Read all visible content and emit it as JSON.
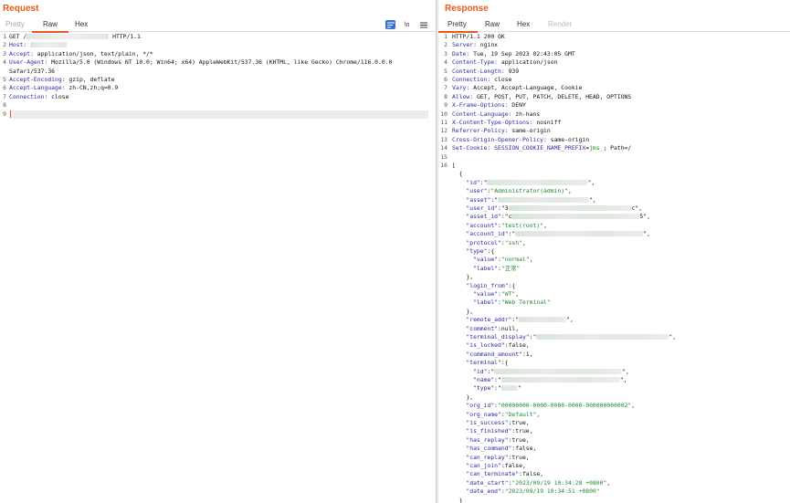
{
  "request": {
    "title": "Request",
    "tabs": [
      "Pretty",
      "Raw",
      "Hex"
    ],
    "active_tab": "Raw",
    "toolbar": {
      "newline_label": "\\n"
    },
    "lines": [
      {
        "n": "1",
        "parts": [
          {
            "t": "GET /",
            "c": "plain"
          },
          {
            "blur": 90,
            "gray": true
          },
          {
            "t": " HTTP/1.1",
            "c": "plain"
          }
        ]
      },
      {
        "n": "2",
        "parts": [
          {
            "t": "Host:",
            "c": "key"
          },
          {
            "t": " ",
            "c": "plain"
          },
          {
            "blur": 40,
            "gray": true
          }
        ]
      },
      {
        "n": "3",
        "parts": [
          {
            "t": "Accept:",
            "c": "key"
          },
          {
            "t": " application/json, text/plain, */*",
            "c": "plain"
          }
        ]
      },
      {
        "n": "4",
        "parts": [
          {
            "t": "User-Agent:",
            "c": "key"
          },
          {
            "t": " Mozilla/5.0 (Windows NT 10.0; Win64; x64) AppleWebKit/537.36 (KHTML, like Gecko) Chrome/116.0.0.0",
            "c": "plain"
          }
        ]
      },
      {
        "n": "",
        "parts": [
          {
            "t": "Safari/537.36",
            "c": "plain"
          }
        ]
      },
      {
        "n": "5",
        "parts": [
          {
            "t": "Accept-Encoding:",
            "c": "key"
          },
          {
            "t": " gzip, deflate",
            "c": "plain"
          }
        ]
      },
      {
        "n": "6",
        "parts": [
          {
            "t": "Accept-Language:",
            "c": "key"
          },
          {
            "t": " zh-CN,zh;q=0.9",
            "c": "plain"
          }
        ]
      },
      {
        "n": "7",
        "parts": [
          {
            "t": "Connection:",
            "c": "key"
          },
          {
            "t": " close",
            "c": "plain"
          }
        ]
      },
      {
        "n": "8",
        "parts": []
      },
      {
        "n": "9",
        "parts": [],
        "cursor": true
      }
    ]
  },
  "response": {
    "title": "Response",
    "tabs": [
      "Pretty",
      "Raw",
      "Hex",
      "Render"
    ],
    "active_tab": "Pretty",
    "lines": [
      {
        "n": "1",
        "parts": [
          {
            "t": "HTTP/1.1 200 OK",
            "c": "plain"
          }
        ]
      },
      {
        "n": "2",
        "parts": [
          {
            "t": "Server:",
            "c": "key"
          },
          {
            "t": " nginx",
            "c": "plain"
          }
        ]
      },
      {
        "n": "3",
        "parts": [
          {
            "t": "Date:",
            "c": "key"
          },
          {
            "t": " Tue, 19 Sep 2023 02:43:05 GMT",
            "c": "plain"
          }
        ]
      },
      {
        "n": "4",
        "parts": [
          {
            "t": "Content-Type:",
            "c": "key"
          },
          {
            "t": " application/json",
            "c": "plain"
          }
        ]
      },
      {
        "n": "5",
        "parts": [
          {
            "t": "Content-Length:",
            "c": "key"
          },
          {
            "t": " 939",
            "c": "plain"
          }
        ]
      },
      {
        "n": "6",
        "parts": [
          {
            "t": "Connection:",
            "c": "key"
          },
          {
            "t": " close",
            "c": "plain"
          }
        ]
      },
      {
        "n": "7",
        "parts": [
          {
            "t": "Vary:",
            "c": "key"
          },
          {
            "t": " Accept, Accept-Language, Cookie",
            "c": "plain"
          }
        ]
      },
      {
        "n": "8",
        "parts": [
          {
            "t": "Allow:",
            "c": "key"
          },
          {
            "t": " GET, POST, PUT, PATCH, DELETE, HEAD, OPTIONS",
            "c": "plain"
          }
        ]
      },
      {
        "n": "9",
        "parts": [
          {
            "t": "X-Frame-Options:",
            "c": "key"
          },
          {
            "t": " DENY",
            "c": "plain"
          }
        ]
      },
      {
        "n": "10",
        "parts": [
          {
            "t": "Content-Language:",
            "c": "key"
          },
          {
            "t": " zh-hans",
            "c": "plain"
          }
        ]
      },
      {
        "n": "11",
        "parts": [
          {
            "t": "X-Content-Type-Options:",
            "c": "key"
          },
          {
            "t": " nosniff",
            "c": "plain"
          }
        ]
      },
      {
        "n": "12",
        "parts": [
          {
            "t": "Referrer-Policy:",
            "c": "key"
          },
          {
            "t": " same-origin",
            "c": "plain"
          }
        ]
      },
      {
        "n": "13",
        "parts": [
          {
            "t": "Cross-Origin-Opener-Policy:",
            "c": "key"
          },
          {
            "t": " same-origin",
            "c": "plain"
          }
        ]
      },
      {
        "n": "14",
        "parts": [
          {
            "t": "Set-Cookie:",
            "c": "key"
          },
          {
            "t": " SESSION_COOKIE_NAME_PREFIX",
            "c": "key"
          },
          {
            "t": "=",
            "c": "plain"
          },
          {
            "t": "jms_",
            "c": "str"
          },
          {
            "t": "; Path=/",
            "c": "plain"
          }
        ]
      },
      {
        "n": "15",
        "parts": []
      },
      {
        "n": "16",
        "parts": [
          {
            "t": "[",
            "c": "plain"
          }
        ]
      },
      {
        "n": "",
        "parts": [
          {
            "t": "  {",
            "c": "plain"
          }
        ]
      },
      {
        "n": "",
        "parts": [
          {
            "t": "    \"id\"",
            "c": "key"
          },
          {
            "t": ":\"",
            "c": "plain"
          },
          {
            "blur": 110
          },
          {
            "t": "\",",
            "c": "plain"
          }
        ]
      },
      {
        "n": "",
        "parts": [
          {
            "t": "    \"user\"",
            "c": "key"
          },
          {
            "t": ":",
            "c": "plain"
          },
          {
            "t": "\"Administrator(admin)\"",
            "c": "str"
          },
          {
            "t": ",",
            "c": "plain"
          }
        ]
      },
      {
        "n": "",
        "parts": [
          {
            "t": "    \"asset\"",
            "c": "key"
          },
          {
            "t": ":\"",
            "c": "plain"
          },
          {
            "blur": 100
          },
          {
            "t": "\",",
            "c": "plain"
          }
        ]
      },
      {
        "n": "",
        "parts": [
          {
            "t": "    \"user_id\"",
            "c": "key"
          },
          {
            "t": ":\"3",
            "c": "plain"
          },
          {
            "blur": 135
          },
          {
            "t": "c\",",
            "c": "plain"
          }
        ]
      },
      {
        "n": "",
        "parts": [
          {
            "t": "    \"asset_id\"",
            "c": "key"
          },
          {
            "t": ":\"c",
            "c": "plain"
          },
          {
            "blur": 140
          },
          {
            "t": "5\",",
            "c": "plain"
          }
        ]
      },
      {
        "n": "",
        "parts": [
          {
            "t": "    \"account\"",
            "c": "key"
          },
          {
            "t": ":",
            "c": "plain"
          },
          {
            "t": "\"test(root)\"",
            "c": "str"
          },
          {
            "t": ",",
            "c": "plain"
          }
        ]
      },
      {
        "n": "",
        "parts": [
          {
            "t": "    \"account_id\"",
            "c": "key"
          },
          {
            "t": ":\"",
            "c": "plain"
          },
          {
            "blur": 140
          },
          {
            "t": "\",",
            "c": "plain"
          }
        ]
      },
      {
        "n": "",
        "parts": [
          {
            "t": "    \"protocol\"",
            "c": "key"
          },
          {
            "t": ":",
            "c": "plain"
          },
          {
            "t": "\"ssh\"",
            "c": "str"
          },
          {
            "t": ",",
            "c": "plain"
          }
        ]
      },
      {
        "n": "",
        "parts": [
          {
            "t": "    \"type\"",
            "c": "key"
          },
          {
            "t": ":{",
            "c": "plain"
          }
        ]
      },
      {
        "n": "",
        "parts": [
          {
            "t": "      \"value\"",
            "c": "key"
          },
          {
            "t": ":",
            "c": "plain"
          },
          {
            "t": "\"normal\"",
            "c": "str"
          },
          {
            "t": ",",
            "c": "plain"
          }
        ]
      },
      {
        "n": "",
        "parts": [
          {
            "t": "      \"label\"",
            "c": "key"
          },
          {
            "t": ":",
            "c": "plain"
          },
          {
            "t": "\"正常\"",
            "c": "str"
          }
        ]
      },
      {
        "n": "",
        "parts": [
          {
            "t": "    },",
            "c": "plain"
          }
        ]
      },
      {
        "n": "",
        "parts": [
          {
            "t": "    \"login_from\"",
            "c": "key"
          },
          {
            "t": ":{",
            "c": "plain"
          }
        ]
      },
      {
        "n": "",
        "parts": [
          {
            "t": "      \"value\"",
            "c": "key"
          },
          {
            "t": ":",
            "c": "plain"
          },
          {
            "t": "\"WT\"",
            "c": "str"
          },
          {
            "t": ",",
            "c": "plain"
          }
        ]
      },
      {
        "n": "",
        "parts": [
          {
            "t": "      \"label\"",
            "c": "key"
          },
          {
            "t": ":",
            "c": "plain"
          },
          {
            "t": "\"Web Terminal\"",
            "c": "str"
          }
        ]
      },
      {
        "n": "",
        "parts": [
          {
            "t": "    },",
            "c": "plain"
          }
        ]
      },
      {
        "n": "",
        "parts": [
          {
            "t": "    \"remote_addr\"",
            "c": "key"
          },
          {
            "t": ":\"",
            "c": "plain"
          },
          {
            "blur": 52
          },
          {
            "t": "\",",
            "c": "plain"
          }
        ]
      },
      {
        "n": "",
        "parts": [
          {
            "t": "    \"comment\"",
            "c": "key"
          },
          {
            "t": ":null,",
            "c": "plain"
          }
        ]
      },
      {
        "n": "",
        "parts": [
          {
            "t": "    \"terminal_display\"",
            "c": "key"
          },
          {
            "t": ":\"",
            "c": "plain"
          },
          {
            "blur": 145
          },
          {
            "t": "\",",
            "c": "plain"
          }
        ]
      },
      {
        "n": "",
        "parts": [
          {
            "t": "    \"is_locked\"",
            "c": "key"
          },
          {
            "t": ":false,",
            "c": "plain"
          }
        ]
      },
      {
        "n": "",
        "parts": [
          {
            "t": "    \"command_amount\"",
            "c": "key"
          },
          {
            "t": ":1,",
            "c": "plain"
          }
        ]
      },
      {
        "n": "",
        "parts": [
          {
            "t": "    \"terminal\"",
            "c": "key"
          },
          {
            "t": ":{",
            "c": "plain"
          }
        ]
      },
      {
        "n": "",
        "parts": [
          {
            "t": "      \"id\"",
            "c": "key"
          },
          {
            "t": ":\"",
            "c": "plain"
          },
          {
            "blur": 140
          },
          {
            "t": "\",",
            "c": "plain"
          }
        ]
      },
      {
        "n": "",
        "parts": [
          {
            "t": "      \"name\"",
            "c": "key"
          },
          {
            "t": ":\"",
            "c": "plain"
          },
          {
            "blur": 130
          },
          {
            "t": "\",",
            "c": "plain"
          }
        ]
      },
      {
        "n": "",
        "parts": [
          {
            "t": "      \"type\"",
            "c": "key"
          },
          {
            "t": ":\"",
            "c": "plain"
          },
          {
            "blur": 18
          },
          {
            "t": "\"",
            "c": "plain"
          }
        ]
      },
      {
        "n": "",
        "parts": [
          {
            "t": "    },",
            "c": "plain"
          }
        ]
      },
      {
        "n": "",
        "parts": [
          {
            "t": "    \"org_id\"",
            "c": "key"
          },
          {
            "t": ":",
            "c": "plain"
          },
          {
            "t": "\"00000000-0000-0000-0000-000000000002\"",
            "c": "str"
          },
          {
            "t": ",",
            "c": "plain"
          }
        ]
      },
      {
        "n": "",
        "parts": [
          {
            "t": "    \"org_name\"",
            "c": "key"
          },
          {
            "t": ":",
            "c": "plain"
          },
          {
            "t": "\"Default\"",
            "c": "str"
          },
          {
            "t": ",",
            "c": "plain"
          }
        ]
      },
      {
        "n": "",
        "parts": [
          {
            "t": "    \"is_success\"",
            "c": "key"
          },
          {
            "t": ":true,",
            "c": "plain"
          }
        ]
      },
      {
        "n": "",
        "parts": [
          {
            "t": "    \"is_finished\"",
            "c": "key"
          },
          {
            "t": ":true,",
            "c": "plain"
          }
        ]
      },
      {
        "n": "",
        "parts": [
          {
            "t": "    \"has_replay\"",
            "c": "key"
          },
          {
            "t": ":true,",
            "c": "plain"
          }
        ]
      },
      {
        "n": "",
        "parts": [
          {
            "t": "    \"has_command\"",
            "c": "key"
          },
          {
            "t": ":false,",
            "c": "plain"
          }
        ]
      },
      {
        "n": "",
        "parts": [
          {
            "t": "    \"can_replay\"",
            "c": "key"
          },
          {
            "t": ":true,",
            "c": "plain"
          }
        ]
      },
      {
        "n": "",
        "parts": [
          {
            "t": "    \"can_join\"",
            "c": "key"
          },
          {
            "t": ":false,",
            "c": "plain"
          }
        ]
      },
      {
        "n": "",
        "parts": [
          {
            "t": "    \"can_terminate\"",
            "c": "key"
          },
          {
            "t": ":false,",
            "c": "plain"
          }
        ]
      },
      {
        "n": "",
        "parts": [
          {
            "t": "    \"date_start\"",
            "c": "key"
          },
          {
            "t": ":",
            "c": "plain"
          },
          {
            "t": "\"2023/09/19 10:34:28 +0800\"",
            "c": "str"
          },
          {
            "t": ",",
            "c": "plain"
          }
        ]
      },
      {
        "n": "",
        "parts": [
          {
            "t": "    \"date_end\"",
            "c": "key"
          },
          {
            "t": ":",
            "c": "plain"
          },
          {
            "t": "\"2023/09/19 10:34:51 +0800\"",
            "c": "str"
          }
        ]
      },
      {
        "n": "",
        "parts": [
          {
            "t": "  }",
            "c": "plain"
          }
        ]
      }
    ]
  }
}
